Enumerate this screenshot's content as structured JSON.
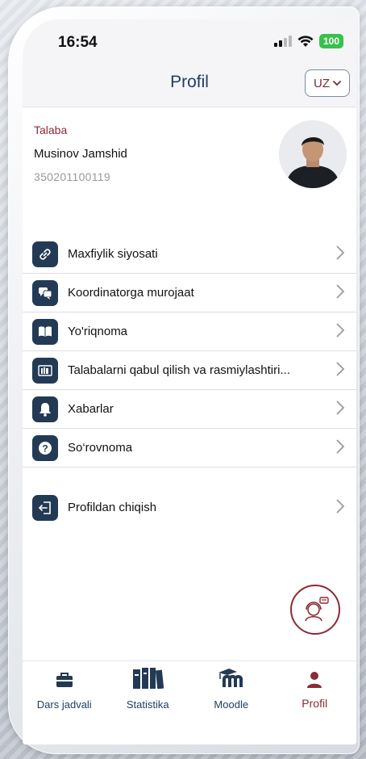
{
  "status_bar": {
    "time": "16:54",
    "battery": "100"
  },
  "header": {
    "title": "Profil",
    "language": "UZ"
  },
  "profile": {
    "role": "Talaba",
    "name": "Musinov Jamshid",
    "student_id": "350201100119"
  },
  "menu": {
    "items": [
      {
        "label": "Maxfiylik siyosati",
        "icon": "link-icon"
      },
      {
        "label": "Koordinatorga murojaat",
        "icon": "chat-icon"
      },
      {
        "label": "Yo'riqnoma",
        "icon": "book-icon"
      },
      {
        "label": "Talabalarni qabul qilish va rasmiylashtiri...",
        "icon": "books-icon"
      },
      {
        "label": "Xabarlar",
        "icon": "bell-icon"
      },
      {
        "label": "So‘rovnoma",
        "icon": "question-icon"
      }
    ],
    "logout": {
      "label": "Profildan chiqish",
      "icon": "logout-icon"
    }
  },
  "tabbar": {
    "items": [
      {
        "label": "Dars jadvali",
        "icon": "briefcase-icon"
      },
      {
        "label": "Statistika",
        "icon": "books-icon"
      },
      {
        "label": "Moodle",
        "icon": "moodle-icon"
      },
      {
        "label": "Profil",
        "icon": "user-icon",
        "active": true
      }
    ]
  },
  "colors": {
    "accent": "#8c2a35",
    "primary": "#233a55",
    "battery": "#38c14b"
  }
}
